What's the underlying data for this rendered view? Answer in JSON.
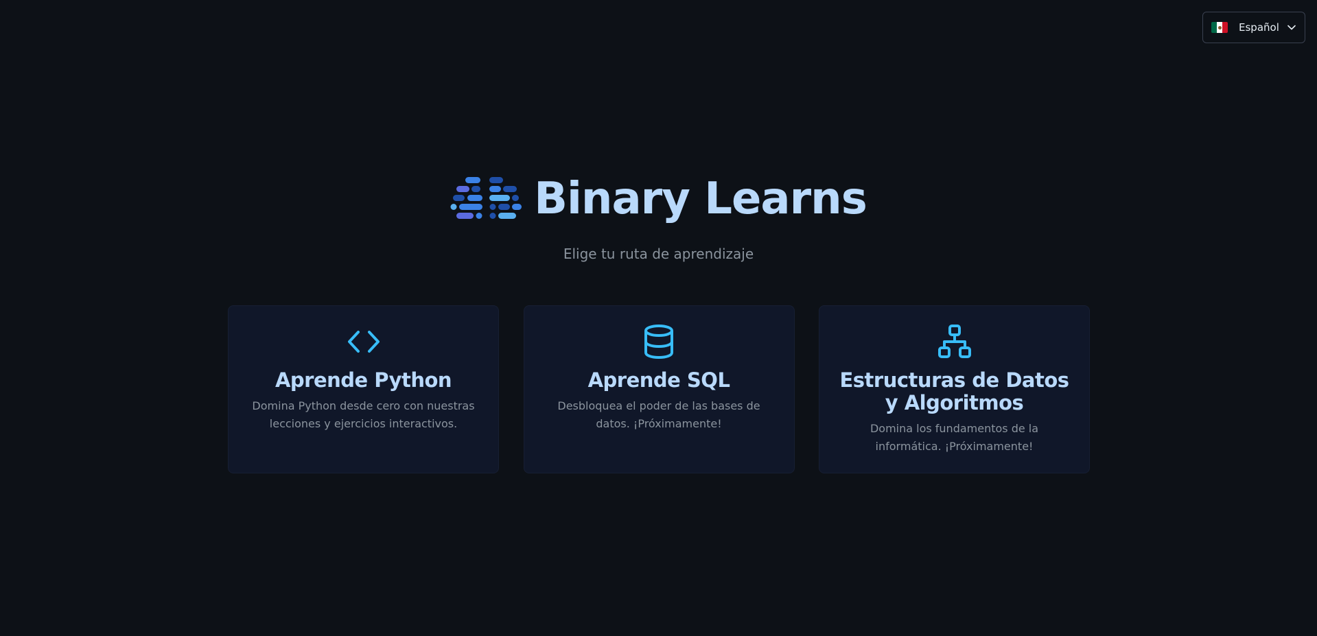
{
  "language": {
    "selected": "Español",
    "flag_icon": "mexico-flag-icon"
  },
  "brand": {
    "title": "Binary Learns",
    "logo_icon": "binary-logo-icon",
    "colors": {
      "title": "#b9d9fb",
      "logo_light": "#5ab0f0",
      "logo_mid": "#3b82e6",
      "logo_dark": "#1f4fa8",
      "logo_violet": "#5b6be0"
    }
  },
  "subtitle": "Elige tu ruta de aprendizaje",
  "cards": [
    {
      "icon": "code-brackets-icon",
      "title": "Aprende Python",
      "description": "Domina Python desde cero con nuestras lecciones y ejercicios interactivos."
    },
    {
      "icon": "database-icon",
      "title": "Aprende SQL",
      "description": "Desbloquea el poder de las bases de datos. ¡Próximamente!"
    },
    {
      "icon": "sitemap-icon",
      "title": "Estructuras de Datos y Algoritmos",
      "description": "Domina los fundamentos de la informática. ¡Próximamente!"
    }
  ],
  "colors": {
    "background": "#0d1117",
    "card_background": "#101729",
    "icon_accent": "#38bdf8",
    "muted_text": "#8b949e"
  }
}
